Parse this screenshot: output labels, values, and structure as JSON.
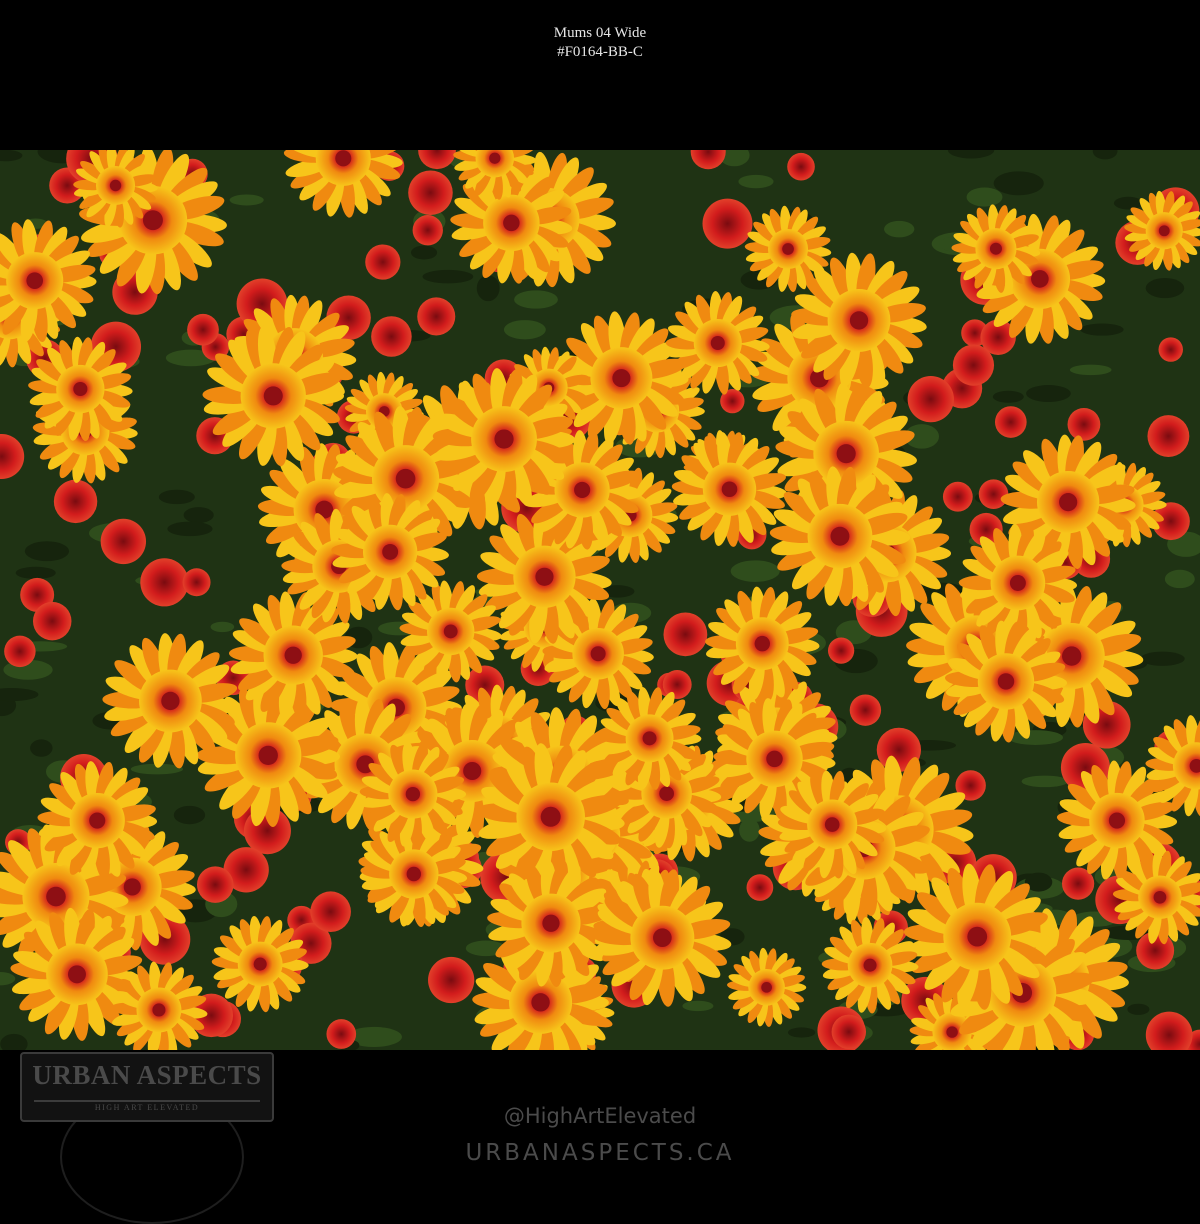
{
  "header": {
    "title": "Mums 04 Wide",
    "code": "#F0164-BB-C"
  },
  "watermark": {
    "logo_text": "URBAN ASPECTS",
    "logo_tagline": "HIGH ART ELEVATED"
  },
  "footer": {
    "handle": "@HighArtElevated",
    "website": "URBANASPECTS.CA"
  },
  "palette": {
    "foliage": "#1f3314",
    "bloom_orange": "#f08a10",
    "bloom_yellow": "#f7c51a",
    "bloom_red": "#d21c1c",
    "bloom_center": "#8e0f14"
  }
}
